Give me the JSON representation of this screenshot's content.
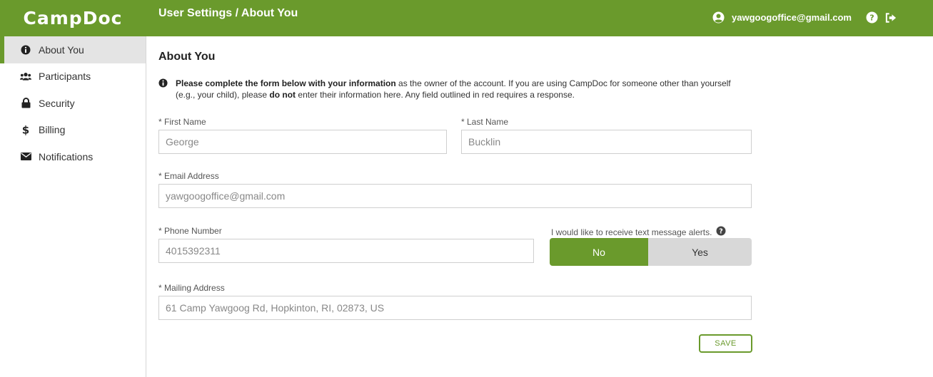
{
  "header": {
    "logo": "CampDoc",
    "breadcrumb": "User Settings / About You",
    "user_email": "yawgoogoffice@gmail.com"
  },
  "sidebar": {
    "items": [
      {
        "label": "About You",
        "icon": "info-circle-icon",
        "active": true
      },
      {
        "label": "Participants",
        "icon": "users-icon",
        "active": false
      },
      {
        "label": "Security",
        "icon": "lock-icon",
        "active": false
      },
      {
        "label": "Billing",
        "icon": "dollar-icon",
        "active": false
      },
      {
        "label": "Notifications",
        "icon": "envelope-icon",
        "active": false
      }
    ]
  },
  "main": {
    "title": "About You",
    "notice": {
      "bold_lead": "Please complete the form below with your information",
      "text_1": " as the owner of the account. If you are using CampDoc for someone other than yourself (e.g., your child), please ",
      "bold_mid": "do not",
      "text_2": " enter their information here. Any field outlined in red requires a response."
    },
    "fields": {
      "first_name": {
        "label": "* First Name",
        "value": "George"
      },
      "last_name": {
        "label": "* Last Name",
        "value": "Bucklin"
      },
      "email": {
        "label": "* Email Address",
        "value": "yawgoogoffice@gmail.com"
      },
      "phone": {
        "label": "* Phone Number",
        "value": "4015392311"
      },
      "address": {
        "label": "* Mailing Address",
        "value": "61 Camp Yawgoog Rd, Hopkinton, RI, 02873, US"
      }
    },
    "text_alerts": {
      "label": "I would like to receive text message alerts.",
      "no_label": "No",
      "yes_label": "Yes",
      "selected": "No"
    },
    "save_label": "SAVE"
  },
  "colors": {
    "brand_green": "#6a9a2c",
    "toggle_inactive": "#d8d8d8",
    "sidebar_active": "#e4e4e4"
  }
}
